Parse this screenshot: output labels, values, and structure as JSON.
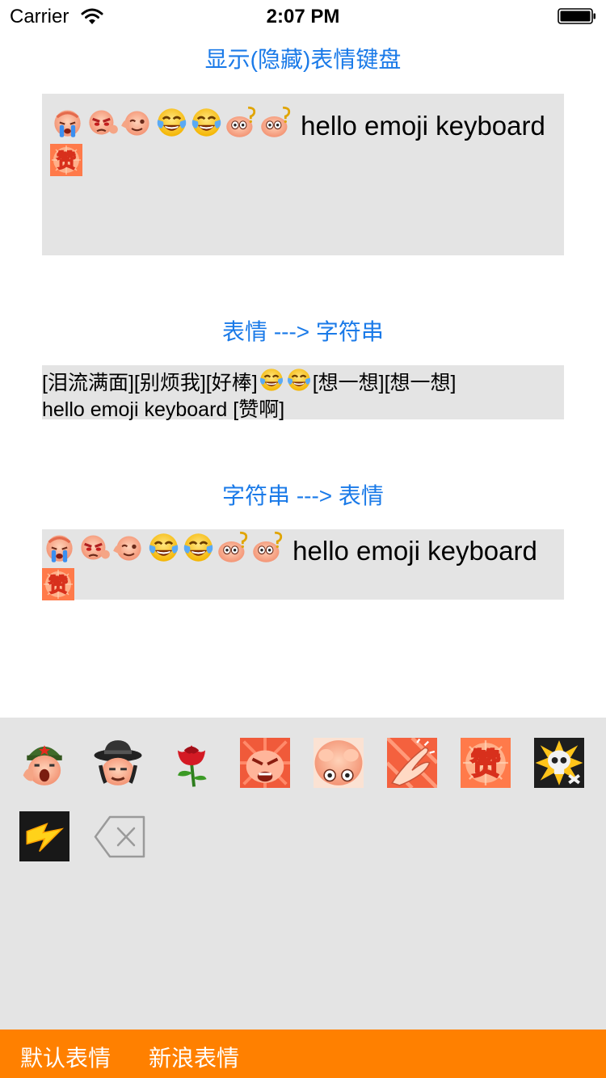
{
  "status_bar": {
    "carrier": "Carrier",
    "time": "2:07 PM",
    "icons": [
      "wifi-icon",
      "battery-icon"
    ]
  },
  "toggle_keyboard_label": "显示(隐藏)表情键盘",
  "input": {
    "emoji_prefix": [
      "cry-face",
      "annoyed-face",
      "thumbs-good-face",
      "tears-of-joy",
      "tears-of-joy",
      "thinking-face",
      "thinking-face"
    ],
    "text": " hello emoji keyboard ",
    "emoji_suffix": [
      "zan-badge"
    ]
  },
  "emoji_to_string": {
    "label": "表情 ---> 字符串",
    "part1": "[泪流满面][别烦我][好棒]",
    "part2": "[想一想][想一想]",
    "part3": "hello emoji keyboard [赞啊]"
  },
  "string_to_emoji": {
    "label": "字符串 ---> 表情",
    "text": " hello emoji keyboard"
  },
  "keyboard": {
    "emojis": [
      "soldier-face",
      "hat-face",
      "rose",
      "angry-face",
      "staring-face",
      "clapping-hands",
      "zan-badge",
      "skull-burst",
      "lightning"
    ],
    "delete_icon": "backspace-icon"
  },
  "tabs": {
    "default_label": "默认表情",
    "sina_label": "新浪表情"
  },
  "colors": {
    "accent": "#1a7ae8",
    "tab_bar": "#ff8000",
    "panel": "#e4e4e4"
  }
}
